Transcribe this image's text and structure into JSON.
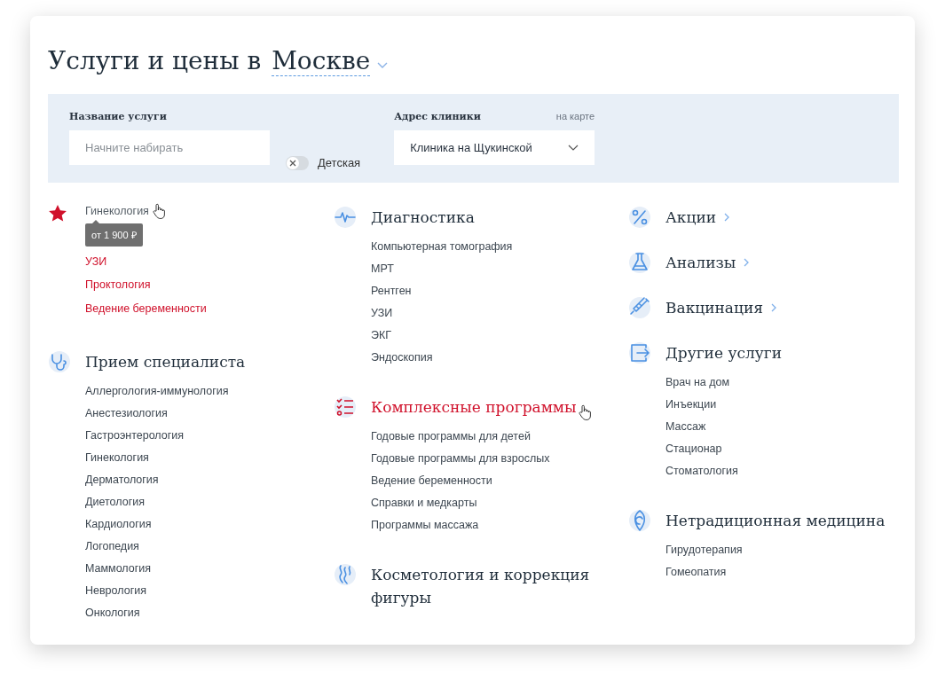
{
  "title": {
    "text": "Услуги и цены в",
    "city": "Москве"
  },
  "filters": {
    "service": {
      "label": "Название услуги",
      "placeholder": "Начните набирать"
    },
    "kids": {
      "label": "Детская",
      "on": false
    },
    "clinic": {
      "label": "Адрес клиники",
      "map_link": "на карте",
      "value": "Клиника на Щукинской"
    }
  },
  "columns": [
    [
      {
        "kind": "favorites",
        "items": [
          {
            "label": "Гинекология",
            "hovered": true,
            "tooltip": "от 1 900 ₽"
          },
          {
            "label": "УЗИ",
            "hovered": false
          },
          {
            "label": "Проктология",
            "hovered": false
          },
          {
            "label": "Ведение беременности",
            "hovered": false
          }
        ]
      },
      {
        "kind": "group",
        "title": "Прием специалиста",
        "highlighted": false,
        "items": [
          "Аллергология-иммунология",
          "Анестезиология",
          "Гастроэнтерология",
          "Гинекология",
          "Дерматология",
          "Диетология",
          "Кардиология",
          "Логопедия",
          "Маммология",
          "Неврология",
          "Онкология"
        ]
      }
    ],
    [
      {
        "kind": "group",
        "title": "Диагностика",
        "highlighted": false,
        "items": [
          "Компьютерная томография",
          "МРТ",
          "Рентген",
          "УЗИ",
          "ЭКГ",
          "Эндоскопия"
        ]
      },
      {
        "kind": "group",
        "title": "Комплексные программы",
        "highlighted": true,
        "items": [
          "Годовые программы для детей",
          "Годовые программы для взрослых",
          "Ведение беременности",
          "Справки и медкарты",
          "Программы массажа"
        ]
      },
      {
        "kind": "group",
        "title": "Косметология и коррекция фигуры",
        "highlighted": false
      }
    ],
    [
      {
        "kind": "link",
        "title": "Акции"
      },
      {
        "kind": "link",
        "title": "Анализы"
      },
      {
        "kind": "link",
        "title": "Вакцинация"
      },
      {
        "kind": "group",
        "title": "Другие услуги",
        "highlighted": false,
        "items": [
          "Врач на дом",
          "Инъекции",
          "Массаж",
          "Стационар",
          "Стоматология"
        ]
      },
      {
        "kind": "group",
        "title": "Нетрадиционная медицина",
        "highlighted": false,
        "items": [
          "Гирудотерапия",
          "Гомеопатия"
        ]
      }
    ]
  ]
}
